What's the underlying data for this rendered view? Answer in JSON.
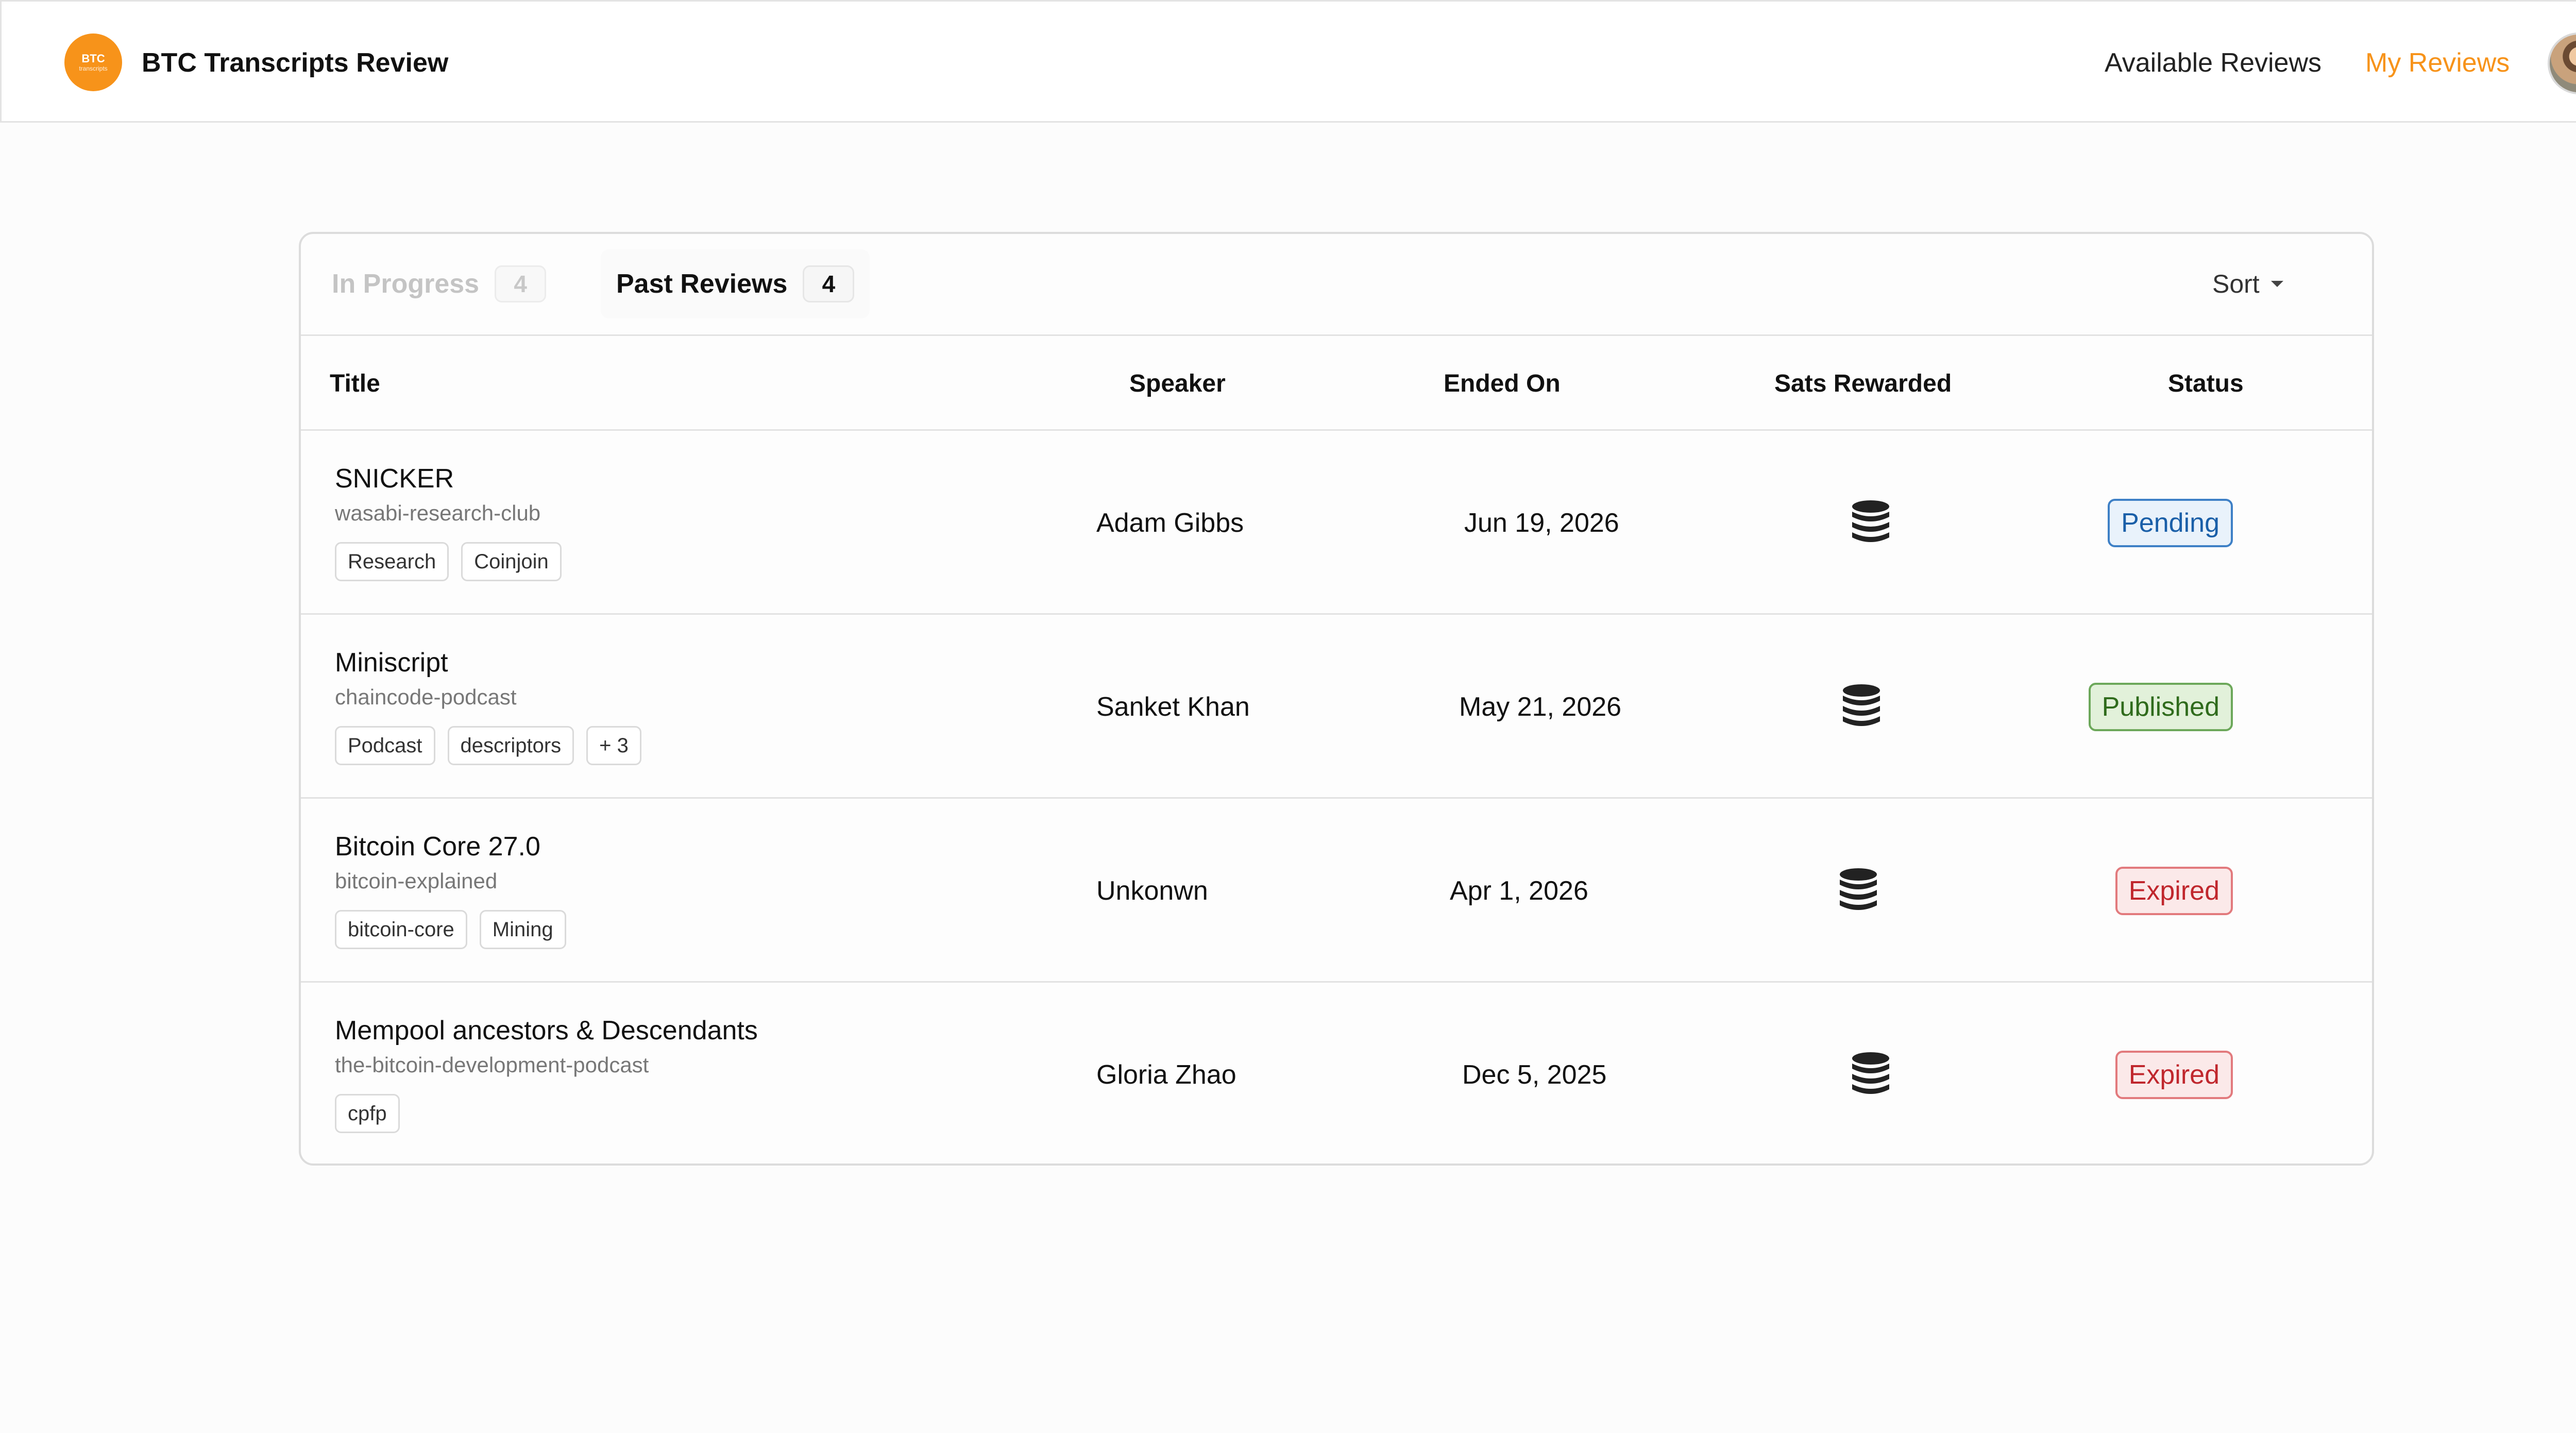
{
  "header": {
    "logo": {
      "line1": "BTC",
      "line2": "transcripts"
    },
    "title": "BTC Transcripts Review",
    "nav": {
      "available": "Available Reviews",
      "mine": "My Reviews"
    },
    "accent_color": "#f7931a"
  },
  "tabs": [
    {
      "label": "In Progress",
      "count": "4",
      "active": false
    },
    {
      "label": "Past Reviews",
      "count": "4",
      "active": true
    }
  ],
  "sort": {
    "label": "Sort"
  },
  "columns": {
    "title": "Title",
    "speaker": "Speaker",
    "ended_on": "Ended On",
    "sats": "Sats Rewarded",
    "status": "Status"
  },
  "rows": [
    {
      "title": "SNICKER",
      "channel": "wasabi-research-club",
      "tags": [
        "Research",
        "Coinjoin"
      ],
      "speaker": "Adam Gibbs",
      "ended_on": "Jun 19, 2026",
      "sats_icon": "coin-stack-icon",
      "status": "Pending",
      "status_color": "#1a5fa8"
    },
    {
      "title": "Miniscript",
      "channel": "chaincode-podcast",
      "tags": [
        "Podcast",
        "descriptors",
        "+ 3"
      ],
      "speaker": "Sanket Khan",
      "ended_on": "May 21, 2026",
      "sats_icon": "coin-stack-icon",
      "status": "Published",
      "status_color": "#2f6b1c"
    },
    {
      "title": "Bitcoin Core 27.0",
      "channel": "bitcoin-explained",
      "tags": [
        "bitcoin-core",
        "Mining"
      ],
      "speaker": "Unkonwn",
      "ended_on": "Apr 1, 2026",
      "sats_icon": "coin-stack-icon",
      "status": "Expired",
      "status_color": "#c0272d"
    },
    {
      "title": "Mempool ancestors & Descendants",
      "channel": "the-bitcoin-development-podcast",
      "tags": [
        "cpfp"
      ],
      "speaker": "Gloria Zhao",
      "ended_on": "Dec 5, 2025",
      "sats_icon": "coin-stack-icon",
      "status": "Expired",
      "status_color": "#c0272d"
    }
  ]
}
